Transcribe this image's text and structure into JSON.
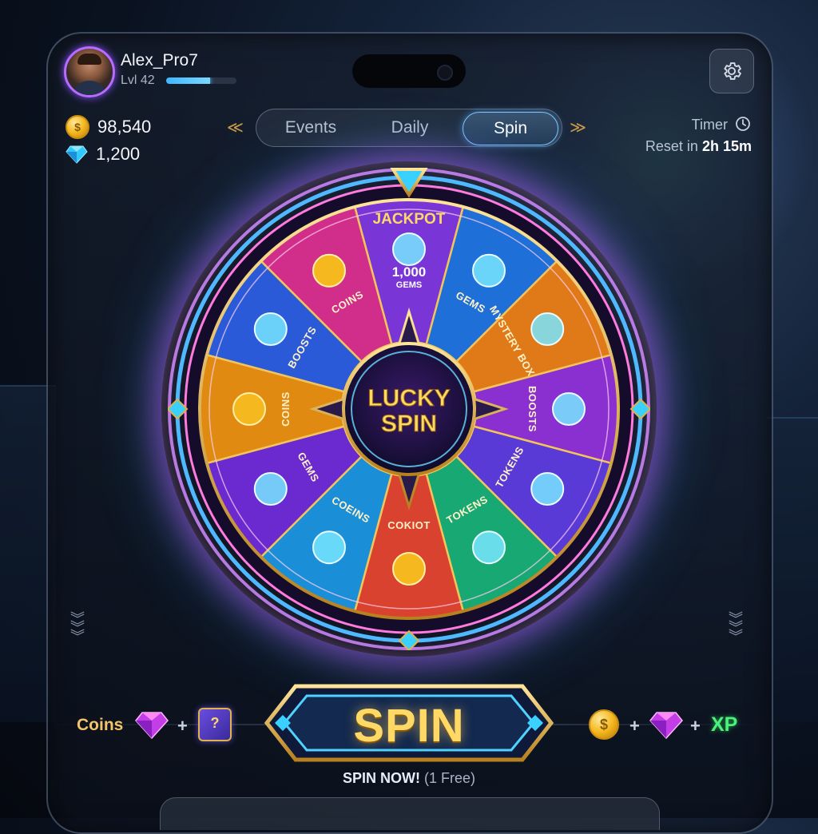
{
  "profile": {
    "username": "Alex_Pro7",
    "level": "Lvl 42",
    "xp_progress": 0.62
  },
  "currency": {
    "coins": "98,540",
    "gems": "1,200"
  },
  "tabs": [
    {
      "label": "Events",
      "active": false
    },
    {
      "label": "Daily",
      "active": false
    },
    {
      "label": "Spin",
      "active": true
    }
  ],
  "timer": {
    "label": "Timer",
    "reset_prefix": "Reset in",
    "reset_value": "2h 15m"
  },
  "wheel": {
    "center_line1": "LUCKY",
    "center_line2": "SPIN",
    "jackpot": "JACKPOT",
    "jackpot_amount": "1,000",
    "jackpot_unit": "GEMS",
    "segments": [
      {
        "label": "JACKPOT",
        "color": "#7a35d6",
        "icon": "gems-icon"
      },
      {
        "label": "GEMS",
        "color": "#1f6fd8",
        "icon": "gem-icon"
      },
      {
        "label": "MYSTERY BOXES",
        "color": "#e07a18",
        "icon": "mystery-box-icon"
      },
      {
        "label": "BOOSTS",
        "color": "#8a2fd0",
        "icon": "boost-icon"
      },
      {
        "label": "TOKENS",
        "color": "#5a3ad6",
        "icon": "token-icon"
      },
      {
        "label": "TOKENS",
        "color": "#18a874",
        "icon": "xp-token-icon"
      },
      {
        "label": "COKIOT",
        "color": "#d8422e",
        "icon": "coin-icon"
      },
      {
        "label": "COEINS",
        "color": "#1a8fd8",
        "icon": "gem-icon"
      },
      {
        "label": "GEMS",
        "color": "#6a2ad0",
        "icon": "gem-icon"
      },
      {
        "label": "COINS",
        "color": "#e08a12",
        "icon": "coin-icon"
      },
      {
        "label": "BOOSTS",
        "color": "#2a5ad8",
        "icon": "boost-cube-icon"
      },
      {
        "label": "COINS",
        "color": "#d02e8a",
        "icon": "coin-icon"
      }
    ]
  },
  "rewards_left": {
    "label": "Coins",
    "plus": "+"
  },
  "rewards_right": {
    "plus1": "+",
    "plus2": "+",
    "xp": "XP"
  },
  "spin_button": {
    "label": "SPIN",
    "sub_main": "SPIN NOW!",
    "sub_note": "(1 Free)"
  },
  "colors": {
    "accent": "#7fc4ff",
    "gold": "#f2c56a",
    "xp_green": "#4df07a"
  }
}
